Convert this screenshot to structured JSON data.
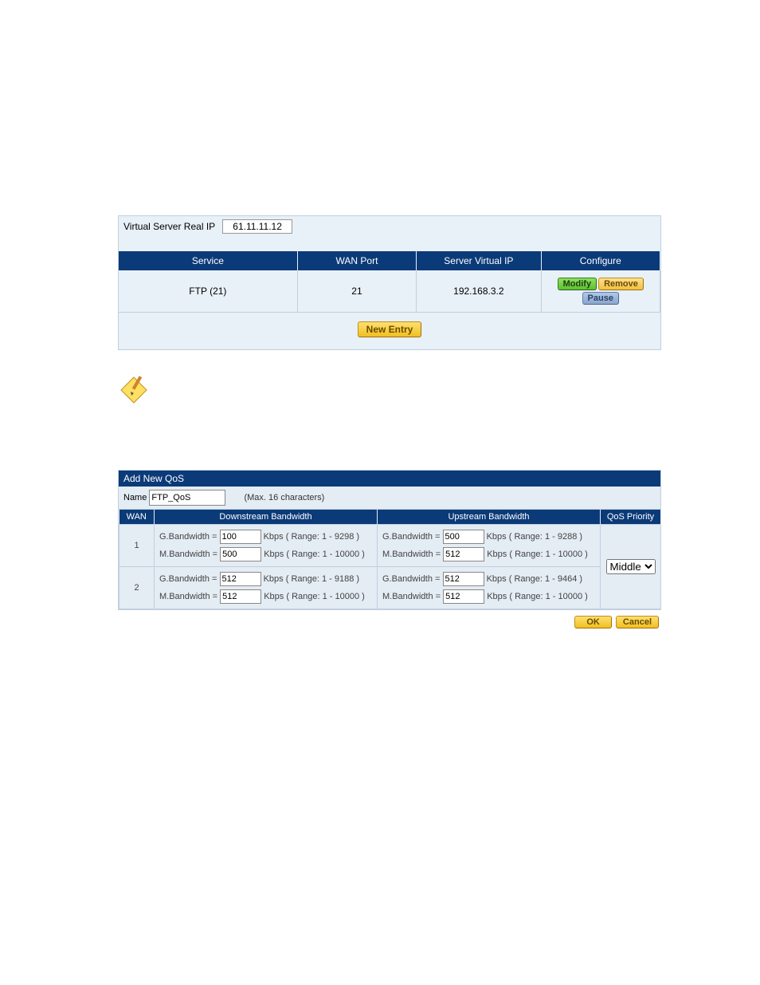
{
  "virtualServer": {
    "realIpLabel": "Virtual Server Real IP",
    "realIp": "61.11.11.12",
    "headers": {
      "service": "Service",
      "wanPort": "WAN Port",
      "virtualIp": "Server Virtual IP",
      "configure": "Configure"
    },
    "row": {
      "service": "FTP (21)",
      "wanPort": "21",
      "virtualIp": "192.168.3.2"
    },
    "buttons": {
      "modify": "Modify",
      "remove": "Remove",
      "pause": "Pause",
      "newEntry": "New Entry"
    }
  },
  "qos": {
    "title": "Add New QoS",
    "nameLabel": "Name",
    "nameValue": "FTP_QoS",
    "nameHint": "(Max. 16 characters)",
    "headers": {
      "wan": "WAN",
      "down": "Downstream Bandwidth",
      "up": "Upstream Bandwidth",
      "prio": "QoS Priority"
    },
    "labels": {
      "g": "G.Bandwidth =",
      "m": "M.Bandwidth =",
      "kbps": "Kbps",
      "rangePrefix": "( Range:"
    },
    "rows": [
      {
        "wan": "1",
        "down": {
          "g": "100",
          "gRange": "1 - 9298",
          "m": "500",
          "mRange": "1 - 10000"
        },
        "up": {
          "g": "500",
          "gRange": "1 - 9288",
          "m": "512",
          "mRange": "1 - 10000"
        }
      },
      {
        "wan": "2",
        "down": {
          "g": "512",
          "gRange": "1 - 9188",
          "m": "512",
          "mRange": "1 - 10000"
        },
        "up": {
          "g": "512",
          "gRange": "1 - 9464",
          "m": "512",
          "mRange": "1 - 10000"
        }
      }
    ],
    "priority": {
      "selected": "Middle"
    },
    "buttons": {
      "ok": "OK",
      "cancel": "Cancel"
    }
  }
}
